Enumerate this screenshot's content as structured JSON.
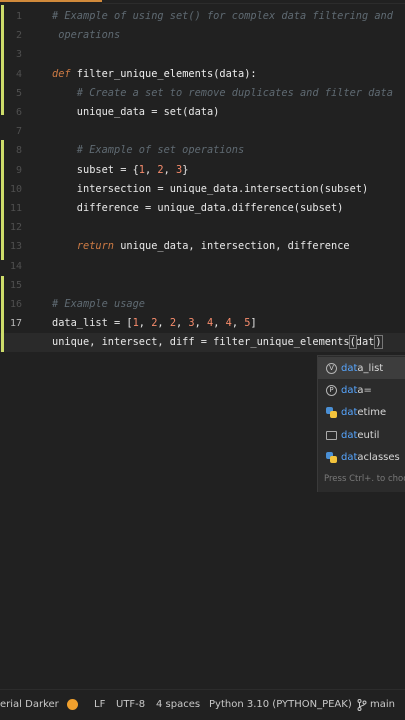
{
  "editor": {
    "line_numbers": [
      "1",
      "2",
      "3",
      "4",
      "5",
      "6",
      "7",
      "8",
      "9",
      "10",
      "11",
      "12",
      "13",
      "14",
      "15",
      "16",
      "17"
    ],
    "code_lines": [
      {
        "segments": [
          {
            "t": "# Example of using set() for complex data filtering and",
            "cls": "c"
          }
        ]
      },
      {
        "segments": [
          {
            "t": " operations",
            "cls": "c"
          }
        ]
      },
      {
        "segments": []
      },
      {
        "segments": [
          {
            "t": "def",
            "cls": "kw"
          },
          {
            "t": " filter_unique_elements(data):",
            "cls": "fn"
          }
        ]
      },
      {
        "segments": [
          {
            "t": "    # Create a set to remove duplicates and filter data",
            "cls": "c"
          }
        ]
      },
      {
        "segments": [
          {
            "t": "    unique_data = set(data)",
            "cls": "plain"
          }
        ]
      },
      {
        "segments": []
      },
      {
        "segments": [
          {
            "t": "    # Example of set operations",
            "cls": "c"
          }
        ]
      },
      {
        "segments": [
          {
            "t": "    subset = {",
            "cls": "plain"
          },
          {
            "t": "1",
            "cls": "num"
          },
          {
            "t": ", ",
            "cls": "plain"
          },
          {
            "t": "2",
            "cls": "num"
          },
          {
            "t": ", ",
            "cls": "plain"
          },
          {
            "t": "3",
            "cls": "num"
          },
          {
            "t": "}",
            "cls": "plain"
          }
        ]
      },
      {
        "segments": [
          {
            "t": "    intersection = unique_data.intersection(subset)",
            "cls": "plain"
          }
        ]
      },
      {
        "segments": [
          {
            "t": "    difference = unique_data.difference(subset)",
            "cls": "plain"
          }
        ]
      },
      {
        "segments": []
      },
      {
        "segments": [
          {
            "t": "    ",
            "cls": "plain"
          },
          {
            "t": "return",
            "cls": "kw"
          },
          {
            "t": " unique_data, intersection, difference",
            "cls": "plain"
          }
        ]
      },
      {
        "segments": []
      },
      {
        "segments": []
      },
      {
        "segments": [
          {
            "t": "# Example usage",
            "cls": "c"
          }
        ]
      },
      {
        "segments": [
          {
            "t": "data_list = [",
            "cls": "plain"
          },
          {
            "t": "1",
            "cls": "num"
          },
          {
            "t": ", ",
            "cls": "plain"
          },
          {
            "t": "2",
            "cls": "num"
          },
          {
            "t": ", ",
            "cls": "plain"
          },
          {
            "t": "2",
            "cls": "num"
          },
          {
            "t": ", ",
            "cls": "plain"
          },
          {
            "t": "3",
            "cls": "num"
          },
          {
            "t": ", ",
            "cls": "plain"
          },
          {
            "t": "4",
            "cls": "num"
          },
          {
            "t": ", ",
            "cls": "plain"
          },
          {
            "t": "4",
            "cls": "num"
          },
          {
            "t": ", ",
            "cls": "plain"
          },
          {
            "t": "5",
            "cls": "num"
          },
          {
            "t": "]",
            "cls": "plain"
          }
        ]
      },
      {
        "segments": [
          {
            "t": "unique, intersect, diff = filter_unique_elements",
            "cls": "plain"
          },
          {
            "t": "(",
            "cls": "cursor-paren"
          },
          {
            "t": "dat",
            "cls": "plain"
          },
          {
            "t": "|caret|",
            "cls": "caret"
          },
          {
            "t": ")",
            "cls": "cursor-paren"
          }
        ]
      }
    ],
    "active_line": "17"
  },
  "autocomplete": {
    "items": [
      {
        "match": "dat",
        "rest": "a_list",
        "icon": "variable-icon",
        "glyph": "V",
        "selected": true
      },
      {
        "match": "dat",
        "rest": "a=",
        "icon": "parameter-icon",
        "glyph": "P",
        "selected": false
      },
      {
        "match": "dat",
        "rest": "etime",
        "icon": "python-module-icon",
        "glyph": "",
        "selected": false
      },
      {
        "match": "dat",
        "rest": "eutil",
        "icon": "folder-package-icon",
        "glyph": "",
        "selected": false
      },
      {
        "match": "dat",
        "rest": "aclasses",
        "icon": "python-module-icon",
        "glyph": "",
        "selected": false
      }
    ],
    "hint": "Press Ctrl+. to choose"
  },
  "status_bar": {
    "theme": "erial Darker",
    "line_ending": "LF",
    "encoding": "UTF-8",
    "indent": "4 spaces",
    "interpreter": "Python 3.10 (PYTHON_PEAK)",
    "branch": "main",
    "accent_color": "#f0a02d"
  }
}
